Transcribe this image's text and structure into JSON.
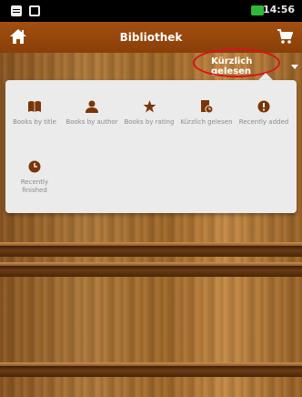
{
  "status_bar": {
    "time": "14:56"
  },
  "app_bar": {
    "title": "Bibliothek"
  },
  "filter": {
    "label": "Kürzlich gelesen"
  },
  "menu": {
    "items": [
      {
        "label": "Books by title"
      },
      {
        "label": "Books by author"
      },
      {
        "label": "Books by rating"
      },
      {
        "label": "Kürzlich gelesen"
      },
      {
        "label": "Recently added"
      },
      {
        "label": "Recently finished"
      }
    ]
  },
  "colors": {
    "app_bar": "#9a4a0e",
    "menu_icon": "#7a3608",
    "highlight_ellipse": "#d8141a",
    "battery": "#2fb83a"
  }
}
